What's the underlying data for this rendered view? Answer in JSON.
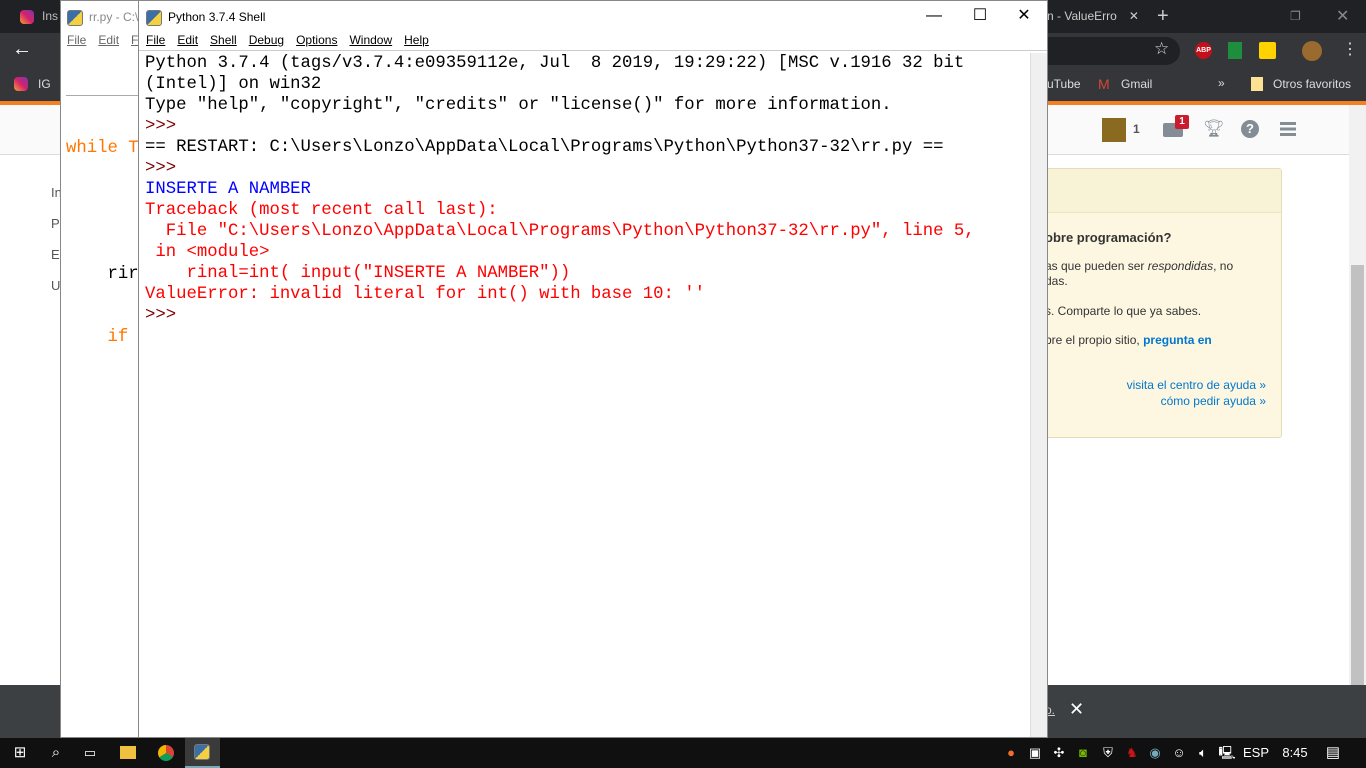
{
  "browser": {
    "tabs": [
      {
        "label": "Ins"
      },
      {
        "label": "n - ValueErro"
      }
    ],
    "new_tab": "+",
    "bookmarks": [
      {
        "label": "IG"
      },
      {
        "label": "uTube"
      },
      {
        "label": "Gmail"
      },
      {
        "label": "»"
      },
      {
        "label": "Otros favoritos"
      }
    ],
    "extensions": {
      "abp": "ABP"
    },
    "accent": "#f48024"
  },
  "so_page": {
    "header": {
      "rep": "1",
      "inbox_badge": "1"
    },
    "sidebar_left": [
      "In",
      "P",
      "E",
      "U"
    ],
    "help_box": {
      "title": "obre programación?",
      "p1a": "as que pueden ser ",
      "p1em": "respondidas",
      "p1b": ", no",
      "p1c": "das.",
      "p2": "s. Comparte lo que ya sabes.",
      "p3a": "bre el propio sitio, ",
      "p3link": "pregunta en",
      "link1": "visita el centro de ayuda »",
      "link2": "cómo pedir ayuda »"
    },
    "bottom_bar": {
      "fragment": "o.",
      "close": "✕"
    }
  },
  "editor": {
    "title": "rr.py - C:\\",
    "menu": [
      "File",
      "Edit",
      "F"
    ],
    "code": [
      {
        "text": "while T",
        "color": "#ff7700"
      },
      {
        "text": "    rir",
        "color": "#000000"
      },
      {
        "text": "    if",
        "color": "#ff7700"
      }
    ]
  },
  "shell": {
    "title": "Python 3.7.4 Shell",
    "menu": [
      "File",
      "Edit",
      "Shell",
      "Debug",
      "Options",
      "Window",
      "Help"
    ],
    "lines": [
      {
        "text": "Python 3.7.4 (tags/v3.7.4:e09359112e, Jul  8 2019, 19:29:22) [MSC v.1916 32 bit",
        "kind": "std"
      },
      {
        "text": "(Intel)] on win32",
        "kind": "std"
      },
      {
        "text": "Type \"help\", \"copyright\", \"credits\" or \"license()\" for more information.",
        "kind": "std"
      },
      {
        "text": ">>> ",
        "kind": "pr"
      },
      {
        "text": "== RESTART: C:\\Users\\Lonzo\\AppData\\Local\\Programs\\Python\\Python37-32\\rr.py ==",
        "kind": "std"
      },
      {
        "text": ">>> ",
        "kind": "pr"
      },
      {
        "text": "INSERTE A NAMBER",
        "kind": "out"
      },
      {
        "text": "Traceback (most recent call last):",
        "kind": "err"
      },
      {
        "text": "  File \"C:\\Users\\Lonzo\\AppData\\Local\\Programs\\Python\\Python37-32\\rr.py\", line 5,",
        "kind": "err"
      },
      {
        "text": " in <module>",
        "kind": "err"
      },
      {
        "text": "    rinal=int( input(\"INSERTE A NAMBER\"))",
        "kind": "err"
      },
      {
        "text": "ValueError: invalid literal for int() with base 10: ''",
        "kind": "err"
      },
      {
        "text": ">>> ",
        "kind": "pr"
      }
    ]
  },
  "taskbar": {
    "language": "ESP",
    "time": "8:45"
  }
}
